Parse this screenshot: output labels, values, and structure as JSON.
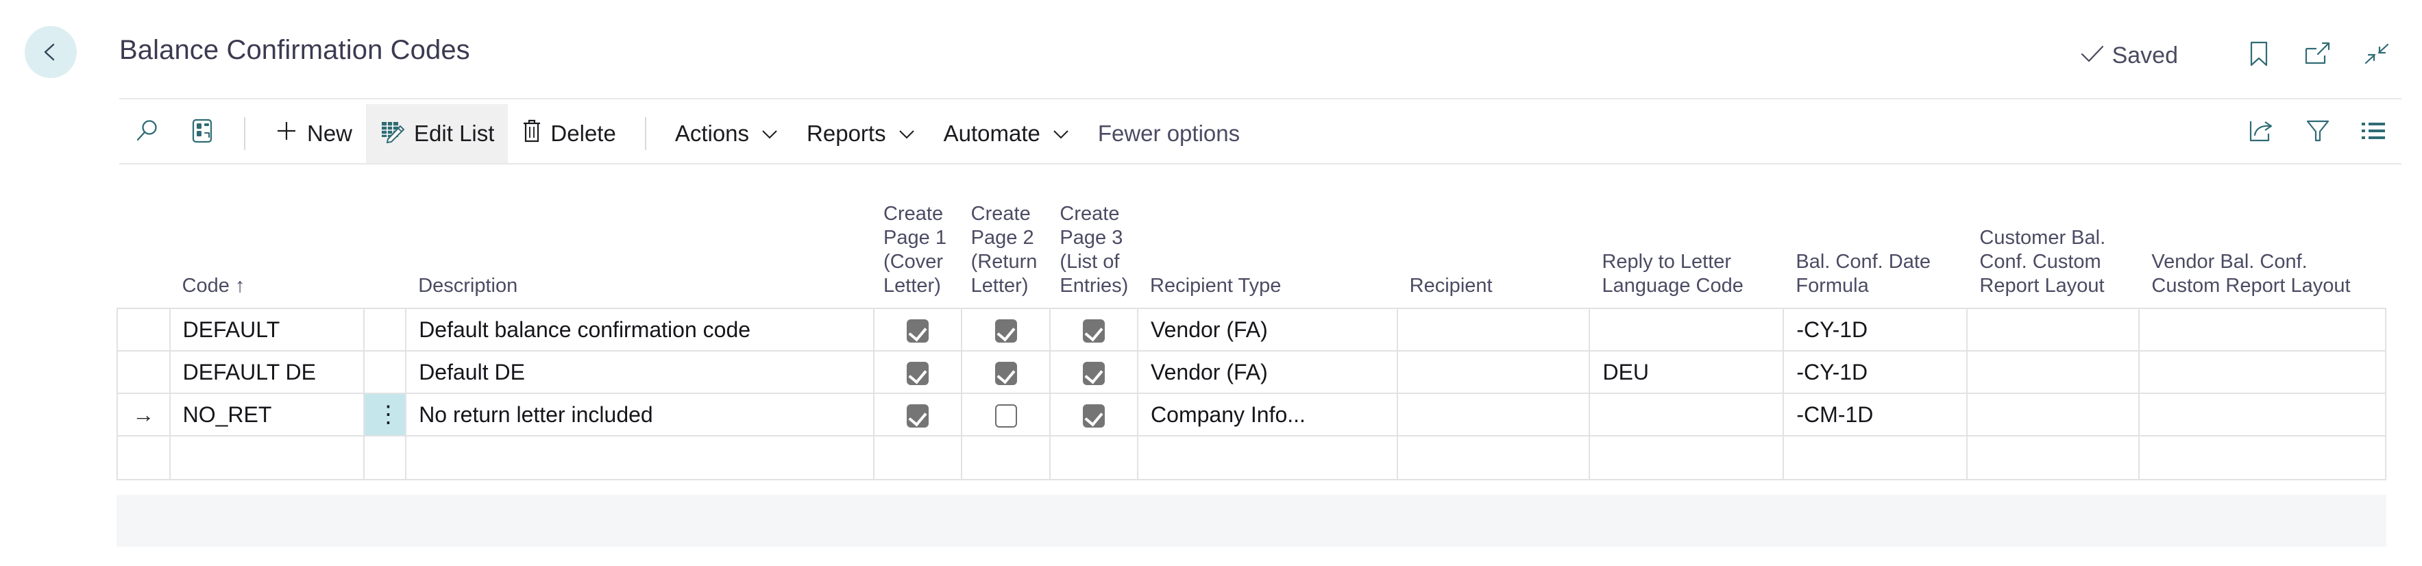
{
  "header": {
    "back_icon": "back-arrow-icon",
    "title": "Balance Confirmation Codes",
    "save_status": "Saved",
    "save_status_icon": "checkmark-icon",
    "bookmark_icon": "bookmark-icon",
    "open_new_window_icon": "open-in-new-window-icon",
    "minimize_icon": "collapse-arrows-icon"
  },
  "toolbar": {
    "search_icon": "search-icon",
    "open_record_icon": "open-record-card-icon",
    "new_label": "New",
    "new_icon": "plus-icon",
    "edit_list_label": "Edit List",
    "edit_list_icon": "edit-list-icon",
    "delete_label": "Delete",
    "delete_icon": "trash-icon",
    "actions_label": "Actions",
    "reports_label": "Reports",
    "automate_label": "Automate",
    "fewer_options_label": "Fewer options",
    "chevron_icon": "chevron-down-icon",
    "share_icon": "share-icon",
    "filter_icon": "filter-funnel-icon",
    "view_options_icon": "list-options-icon"
  },
  "grid": {
    "columns": [
      {
        "label": "",
        "name": "row-indicator"
      },
      {
        "label": "Code ↑",
        "name": "code"
      },
      {
        "label": "",
        "name": "row-menu"
      },
      {
        "label": "Description",
        "name": "description"
      },
      {
        "label": "Create Page 1 (Cover Letter)",
        "name": "create-page-1"
      },
      {
        "label": "Create Page 2 (Return Letter)",
        "name": "create-page-2"
      },
      {
        "label": "Create Page 3 (List of Entries)",
        "name": "create-page-3"
      },
      {
        "label": "Recipient Type",
        "name": "recipient-type"
      },
      {
        "label": "Recipient",
        "name": "recipient"
      },
      {
        "label": "Reply to Letter Language Code",
        "name": "reply-to-letter-language-code"
      },
      {
        "label": "Bal. Conf. Date Formula",
        "name": "bal-conf-date-formula"
      },
      {
        "label": "Customer Bal. Conf. Custom Report Layout",
        "name": "customer-bal-conf-custom-report-layout"
      },
      {
        "label": "Vendor Bal. Conf. Custom Report Layout",
        "name": "vendor-bal-conf-custom-report-layout"
      }
    ],
    "sort_column": "Code",
    "sort_direction": "ascending",
    "rows": [
      {
        "selected": false,
        "indicator": "",
        "code": "DEFAULT",
        "description": "Default balance confirmation code",
        "create_page_1": true,
        "create_page_2": true,
        "create_page_3": true,
        "recipient_type": "Vendor (FA)",
        "recipient": "",
        "reply_to_letter_language_code": "",
        "bal_conf_date_formula": "-CY-1D",
        "customer_bal_conf_custom_report_layout": "",
        "vendor_bal_conf_custom_report_layout": ""
      },
      {
        "selected": false,
        "indicator": "",
        "code": "DEFAULT DE",
        "description": "Default DE",
        "create_page_1": true,
        "create_page_2": true,
        "create_page_3": true,
        "recipient_type": "Vendor (FA)",
        "recipient": "",
        "reply_to_letter_language_code": "DEU",
        "bal_conf_date_formula": "-CY-1D",
        "customer_bal_conf_custom_report_layout": "",
        "vendor_bal_conf_custom_report_layout": ""
      },
      {
        "selected": true,
        "indicator": "→",
        "code": "NO_RET",
        "description": "No return letter included",
        "create_page_1": true,
        "create_page_2": false,
        "create_page_3": true,
        "recipient_type": "Company Info...",
        "recipient": "",
        "reply_to_letter_language_code": "",
        "bal_conf_date_formula": "-CM-1D",
        "customer_bal_conf_custom_report_layout": "",
        "vendor_bal_conf_custom_report_layout": ""
      },
      {
        "selected": false,
        "indicator": "",
        "code": "",
        "description": "",
        "create_page_1": null,
        "create_page_2": null,
        "create_page_3": null,
        "recipient_type": "",
        "recipient": "",
        "reply_to_letter_language_code": "",
        "bal_conf_date_formula": "",
        "customer_bal_conf_custom_report_layout": "",
        "vendor_bal_conf_custom_report_layout": ""
      }
    ],
    "row_menu_glyph": "⋮"
  },
  "colors": {
    "accent": "#2f6b74",
    "selection": "#c5e7eb",
    "back_button_bg": "#dceef1",
    "title_text": "#3b3a51",
    "grid_border": "#e2e2e5",
    "footer_band": "#f4f6f8",
    "checkbox_fill": "#757575"
  }
}
